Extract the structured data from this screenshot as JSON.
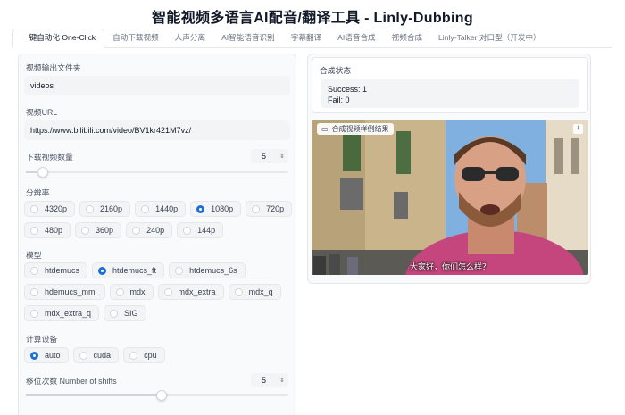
{
  "app": {
    "title": "智能视频多语言AI配音/翻译工具 - Linly-Dubbing"
  },
  "tabs": [
    {
      "label": "一键自动化 One-Click",
      "active": true
    },
    {
      "label": "自动下载视频"
    },
    {
      "label": "人声分离"
    },
    {
      "label": "AI智能语音识别"
    },
    {
      "label": "字幕翻译"
    },
    {
      "label": "AI语音合成"
    },
    {
      "label": "视频合成"
    },
    {
      "label": "Linly-Talker 对口型（开发中）"
    }
  ],
  "form": {
    "output_folder": {
      "label": "视频输出文件夹",
      "value": "videos"
    },
    "video_url": {
      "label": "视频URL",
      "value": "https://www.bilibili.com/video/BV1kr421M7vz/"
    },
    "download_count": {
      "label": "下载视频数量",
      "value": "5",
      "slider_fraction": 0.04
    },
    "resolution": {
      "label": "分辨率",
      "options": [
        "4320p",
        "2160p",
        "1440p",
        "1080p",
        "720p",
        "480p",
        "360p",
        "240p",
        "144p"
      ],
      "selected": "1080p"
    },
    "model": {
      "label": "模型",
      "options": [
        "htdemucs",
        "htdemucs_ft",
        "htdemucs_6s",
        "hdemucs_mmi",
        "mdx",
        "mdx_extra",
        "mdx_q",
        "mdx_extra_q",
        "SIG"
      ],
      "selected": "htdemucs_ft"
    },
    "device": {
      "label": "计算设备",
      "options": [
        "auto",
        "cuda",
        "cpu"
      ],
      "selected": "auto"
    },
    "shifts": {
      "label": "移位次数 Number of shifts",
      "value": "5",
      "slider_fraction": 0.5
    }
  },
  "result": {
    "status_label": "合成状态",
    "status_success": "Success: 1",
    "status_fail": "Fail: 0",
    "video_label": "合成视频样例结果",
    "video_subtitle": "大家好，你们怎么样？"
  },
  "icons": {
    "video": "video-camera-icon",
    "download": "download-icon",
    "spinner": "number-spinner-icon"
  },
  "colors": {
    "accent": "#1d6fd6",
    "panel_bg": "#f9fafb",
    "input_bg": "#f3f4f6"
  }
}
